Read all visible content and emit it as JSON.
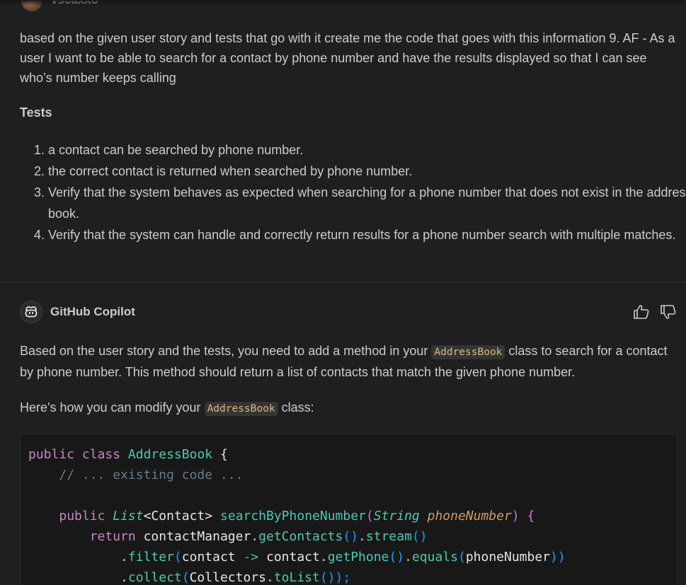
{
  "user_message": {
    "name": "vscaxxo",
    "text": "based on the given user story and tests that go with it create me the code that goes with this information 9. AF - As a user I want to be able to search for a contact by phone number and have the results displayed so that I can see who’s number keeps calling",
    "tests_heading": "Tests",
    "tests": [
      "a contact can be searched by phone number.",
      "the correct contact is returned when searched by phone number.",
      "Verify that the system behaves as expected when searching for a phone number that does not exist in the address book.",
      "Verify that the system can handle and correctly return results for a phone number search with multiple matches."
    ]
  },
  "copilot_message": {
    "name": "GitHub Copilot",
    "icon": "copilot-icon",
    "thumbs_up_icon": "thumbs-up-icon",
    "thumbs_down_icon": "thumbs-down-icon",
    "para1_before": "Based on the user story and the tests, you need to add a method in your ",
    "para1_code": "AddressBook",
    "para1_after": " class to search for a contact by phone number. This method should return a list of contacts that match the given phone number.",
    "para2_before": "Here's how you can modify your ",
    "para2_code": "AddressBook",
    "para2_after": " class:",
    "code": {
      "line1": {
        "kw1": "public",
        "kw2": "class",
        "cls": "AddressBook",
        "brace": "{"
      },
      "line2": "// ... existing code ...",
      "line4": {
        "kw": "public",
        "type": "List",
        "generic": "<Contact>",
        "fn": "searchByPhoneNumber",
        "paramType": "String",
        "param": "phoneNumber",
        "brace": "{"
      },
      "line5": {
        "kw": "return",
        "obj": "contactManager",
        "m1": "getContacts",
        "m2": "stream"
      },
      "line6": {
        "m": "filter",
        "arg": "contact",
        "arrow": "->",
        "obj": "contact",
        "m2": "getPhone",
        "m3": "equals",
        "arg2": "phoneNumber"
      },
      "line7": {
        "m": "collect",
        "obj": "Collectors",
        "m2": "toList"
      }
    }
  },
  "colors": {
    "background": "#1f1f1f",
    "text": "#cccccc",
    "inline_code": "#d7ba7d",
    "keyword": "#c586c0",
    "class": "#4ec9b0",
    "comment": "#6a7a8c"
  }
}
